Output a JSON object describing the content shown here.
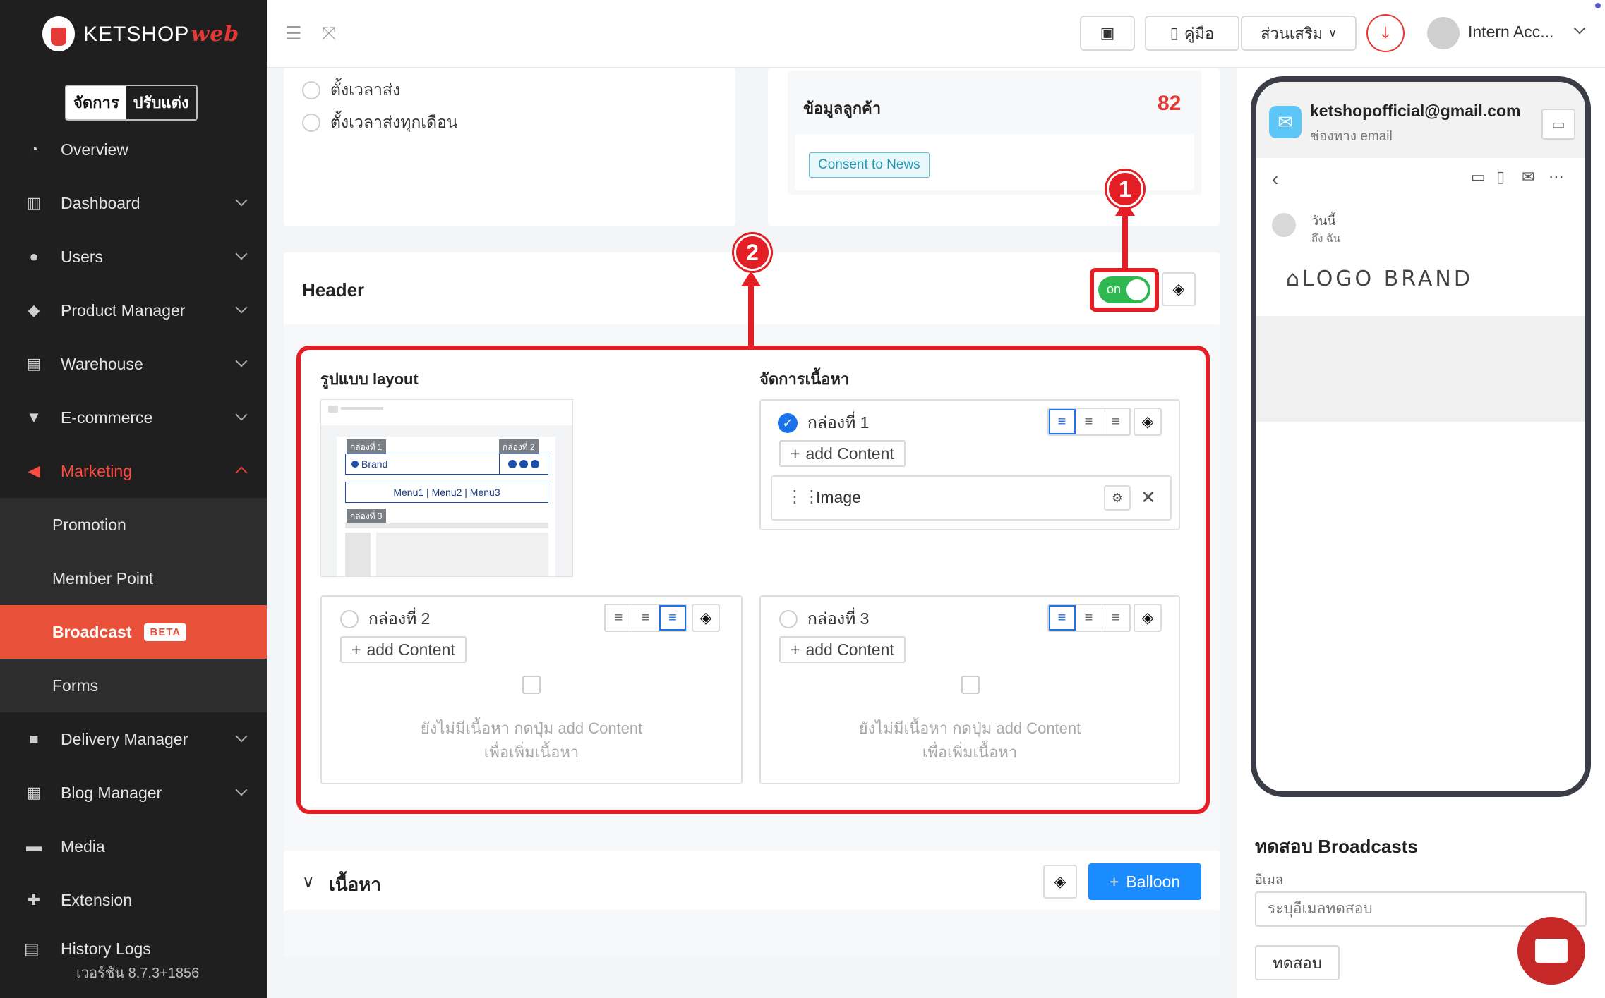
{
  "brand": {
    "name": "KETSHOP",
    "suffix": "web"
  },
  "mode": {
    "manage": "จัดการ",
    "customize": "ปรับแต่ง"
  },
  "nav": {
    "overview": "Overview",
    "dashboard": "Dashboard",
    "users": "Users",
    "product_manager": "Product Manager",
    "warehouse": "Warehouse",
    "ecommerce": "E-commerce",
    "marketing": "Marketing",
    "promotion": "Promotion",
    "member_point": "Member Point",
    "broadcast": "Broadcast",
    "broadcast_badge": "BETA",
    "forms": "Forms",
    "delivery_manager": "Delivery Manager",
    "blog_manager": "Blog Manager",
    "media": "Media",
    "extension": "Extension",
    "history_logs": "History Logs",
    "version": "เวอร์ชัน 8.7.3+1856"
  },
  "topbar": {
    "manual": "คู่มือ",
    "addons": "ส่วนเสริม",
    "user": "Intern Acc..."
  },
  "schedule": {
    "option_schedule": "ตั้งเวลาส่ง",
    "option_monthly": "ตั้งเวลาส่งทุกเดือน"
  },
  "customer": {
    "title": "ข้อมูลลูกค้า",
    "count": "82",
    "tag": "Consent to News"
  },
  "header_section": {
    "title": "Header",
    "toggle_label": "on",
    "layout_label": "รูปแบบ layout",
    "content_label": "จัดการเนื้อหา",
    "thumb": {
      "box1": "กล่องที่ 1",
      "box2": "กล่องที่ 2",
      "box3": "กล่องที่ 3",
      "brand": "Brand",
      "menu": "Menu1 | Menu2 | Menu3"
    },
    "box1": {
      "title": "กล่องที่ 1",
      "add": "add Content",
      "item": "Image"
    },
    "box2": {
      "title": "กล่องที่ 2",
      "add": "add Content",
      "empty": "ยังไม่มีเนื้อหา กดปุ่ม add Content",
      "empty2": "เพื่อเพิ่มเนื้อหา"
    },
    "box3": {
      "title": "กล่องที่ 3",
      "add": "add Content",
      "empty": "ยังไม่มีเนื้อหา กดปุ่ม add Content",
      "empty2": "เพื่อเพิ่มเนื้อหา"
    }
  },
  "content_section": {
    "title": "เนื้อหา",
    "balloon": "Balloon"
  },
  "annotations": {
    "one": "1",
    "two": "2"
  },
  "preview": {
    "email": "ketshopofficial@gmail.com",
    "channel": "ช่องทาง email",
    "today": "วันนี้",
    "to": "ถึง ฉัน",
    "logo": "LOGO BRAND"
  },
  "test": {
    "title": "ทดสอบ Broadcasts",
    "label": "อีเมล",
    "placeholder": "ระบุอีเมลทดสอบ",
    "button": "ทดสอบ"
  },
  "colors": {
    "accent": "#e8503a",
    "annotation": "#e31e24",
    "primary": "#1a8cff",
    "toggle_on": "#2eb84f"
  }
}
